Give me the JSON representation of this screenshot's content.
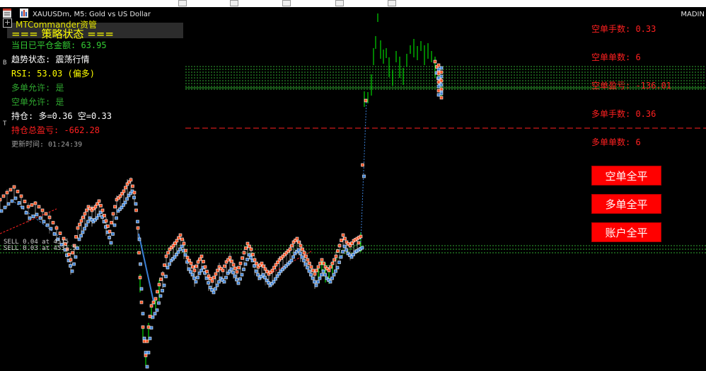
{
  "window": {
    "title": "XAUUSDm, M5:  Gold vs US Dollar",
    "broker_tag": "MADIN"
  },
  "icons": [
    "window-menu-icon",
    "chart-symbol-icon",
    "expand-plus-icon"
  ],
  "panel": {
    "commander_label": "MTCommander资管",
    "title": "=== 策略状态 ===",
    "closed_amount": "当日已平仓金额: 63.95",
    "trend_state": "趋势状态: 震荡行情",
    "rsi": "RSI: 53.03 (偏多)",
    "long_allowed": "多单允许: 是",
    "short_allowed": "空单允许: 是",
    "position": "持仓: 多=0.36 空=0.33",
    "total_pnl": "持仓总盈亏: -662.28",
    "update_time": "更新时间: 01:24:39"
  },
  "right_panel": {
    "short_lots": "空单手数: 0.33",
    "short_count": "空单单数: 6",
    "short_pnl": "空单盈亏: -136.01",
    "long_lots": "多单手数: 0.36",
    "long_count": "多单单数: 6"
  },
  "buttons": {
    "close_shorts": "空单全平",
    "close_longs": "多单全平",
    "close_account": "账户全平"
  },
  "axis_tags": {
    "sell_1": "SELL 0.04 at 4515",
    "sell_2": "SELL 0.03 at 4531.5",
    "left_letter_b": "B",
    "left_letter_t": "T"
  },
  "colors": {
    "background": "#000000",
    "yellow": "#ffff00",
    "green": "#33cc33",
    "red": "#ff2020",
    "button_red": "#ff0000",
    "candle_green": "#00ff00",
    "buy_marker": "#3a7fd5",
    "sell_marker": "#ff5020"
  }
}
